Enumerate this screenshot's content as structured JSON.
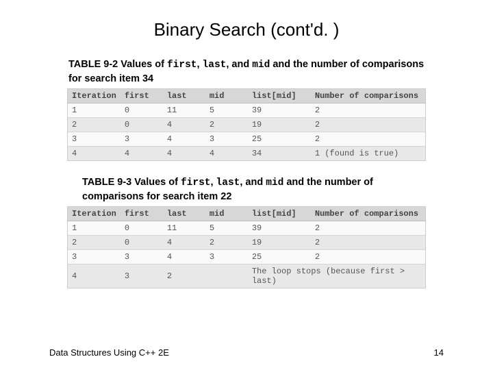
{
  "title": "Binary Search (cont'd. )",
  "table1": {
    "caption_prefix": "TABLE 9-2 Values of ",
    "code1": "first",
    "sep1": ", ",
    "code2": "last",
    "sep2": ", and ",
    "code3": "mid",
    "caption_mid": " and the number of comparisons for search item 34",
    "headers": [
      "Iteration",
      "first",
      "last",
      "mid",
      "list[mid]",
      "Number of comparisons"
    ],
    "rows": [
      [
        "1",
        "0",
        "11",
        "5",
        "39",
        "2"
      ],
      [
        "2",
        "0",
        "4",
        "2",
        "19",
        "2"
      ],
      [
        "3",
        "3",
        "4",
        "3",
        "25",
        "2"
      ],
      [
        "4",
        "4",
        "4",
        "4",
        "34",
        "1 (found is true)"
      ]
    ]
  },
  "table2": {
    "caption_prefix": "TABLE 9-3 Values of ",
    "code1": "first",
    "sep1": ", ",
    "code2": "last",
    "sep2": ", and ",
    "code3": "mid",
    "caption_mid": " and the number of comparisons for search item 22",
    "headers": [
      "Iteration",
      "first",
      "last",
      "mid",
      "list[mid]",
      "Number of comparisons"
    ],
    "rows": [
      [
        "1",
        "0",
        "11",
        "5",
        "39",
        "2"
      ],
      [
        "2",
        "0",
        "4",
        "2",
        "19",
        "2"
      ],
      [
        "3",
        "3",
        "4",
        "3",
        "25",
        "2"
      ],
      [
        "4",
        "3",
        "2",
        "",
        {
          "span": 3,
          "text": "The loop stops (because first > last)"
        }
      ]
    ]
  },
  "footer_left": "Data Structures Using C++ 2E",
  "footer_right": "14"
}
